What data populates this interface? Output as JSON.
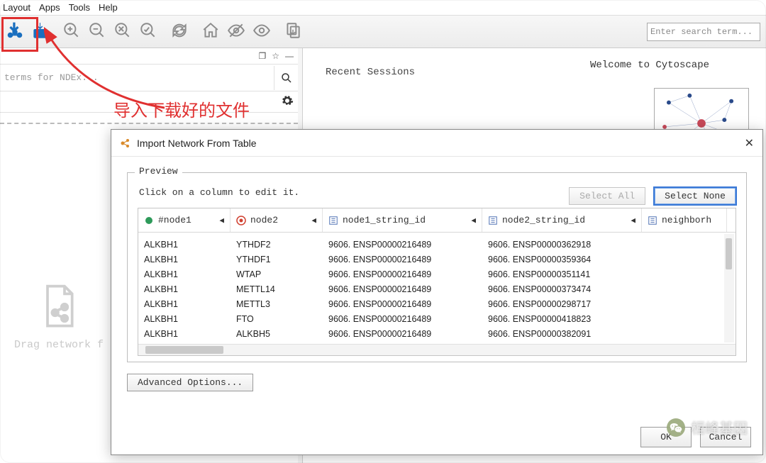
{
  "menu": {
    "layout": "Layout",
    "apps": "Apps",
    "tools": "Tools",
    "help": "Help"
  },
  "toolbar": {
    "search_placeholder": "Enter search term..."
  },
  "leftPanel": {
    "ndex_placeholder": "terms for NDEx...",
    "drop_hint": "Drag network f"
  },
  "panelControls": {
    "window": "❐",
    "pin": "☆",
    "min": "—"
  },
  "main": {
    "recent": "Recent Sessions",
    "welcome": "Welcome to Cytoscape"
  },
  "annotation": {
    "text": "导入下载好的文件"
  },
  "dialog": {
    "title": "Import Network From Table",
    "fieldset_legend": "Preview",
    "hint": "Click on a column to edit it.",
    "select_all": "Select All",
    "select_none": "Select None",
    "advanced": "Advanced Options...",
    "ok": "OK",
    "cancel": "Cancel",
    "columns": {
      "c1": "#node1",
      "c2": "node2",
      "c3": "node1_string_id",
      "c4": "node2_string_id",
      "c5": "neighborh"
    },
    "rows": [
      {
        "n1": "ALKBH1",
        "n2": "YTHDF2",
        "s1": "9606. ENSP00000216489",
        "s2": "9606. ENSP00000362918"
      },
      {
        "n1": "ALKBH1",
        "n2": "YTHDF1",
        "s1": "9606. ENSP00000216489",
        "s2": "9606. ENSP00000359364"
      },
      {
        "n1": "ALKBH1",
        "n2": "WTAP",
        "s1": "9606. ENSP00000216489",
        "s2": "9606. ENSP00000351141"
      },
      {
        "n1": "ALKBH1",
        "n2": "METTL14",
        "s1": "9606. ENSP00000216489",
        "s2": "9606. ENSP00000373474"
      },
      {
        "n1": "ALKBH1",
        "n2": "METTL3",
        "s1": "9606. ENSP00000216489",
        "s2": "9606. ENSP00000298717"
      },
      {
        "n1": "ALKBH1",
        "n2": "FTO",
        "s1": "9606. ENSP00000216489",
        "s2": "9606. ENSP00000418823"
      },
      {
        "n1": "ALKBH1",
        "n2": "ALKBH5",
        "s1": "9606. ENSP00000216489",
        "s2": "9606. ENSP00000382091"
      }
    ]
  },
  "watermark": {
    "text": "桓峰基因"
  }
}
